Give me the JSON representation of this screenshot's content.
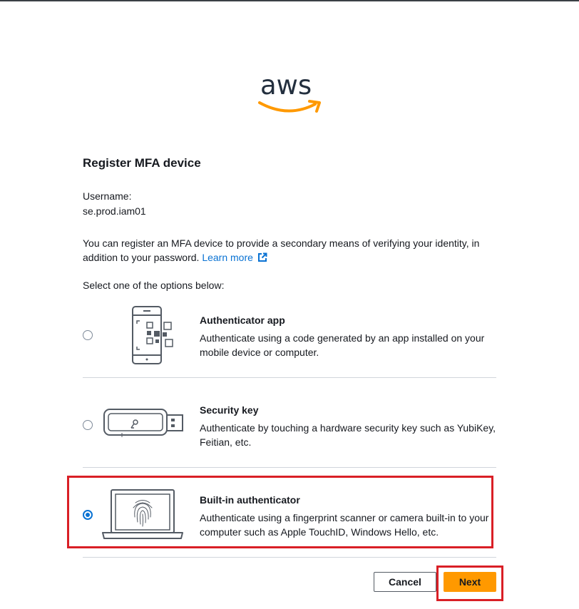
{
  "brand": {
    "logo_text": "aws",
    "smile_color": "#ff9900"
  },
  "page": {
    "title": "Register MFA device",
    "username_label": "Username:",
    "username_value": "se.prod.iam01",
    "intro_text": "You can register an MFA device to provide a secondary means of verifying your identity, in addition to your password.",
    "learn_more": "Learn more",
    "instruction": "Select one of the options below:"
  },
  "options": [
    {
      "title": "Authenticator app",
      "description": "Authenticate using a code generated by an app installed on your mobile device or computer.",
      "selected": false,
      "icon": "phone-qr-icon"
    },
    {
      "title": "Security key",
      "description": "Authenticate by touching a hardware security key such as YubiKey, Feitian, etc.",
      "selected": false,
      "icon": "usb-key-icon"
    },
    {
      "title": "Built-in authenticator",
      "description": "Authenticate using a fingerprint scanner or camera built-in to your computer such as Apple TouchID, Windows Hello, etc.",
      "selected": true,
      "icon": "laptop-fingerprint-icon"
    }
  ],
  "actions": {
    "cancel_label": "Cancel",
    "next_label": "Next"
  },
  "colors": {
    "accent": "#0972d3",
    "primary_button": "#ff9900",
    "highlight": "#d91f26"
  }
}
